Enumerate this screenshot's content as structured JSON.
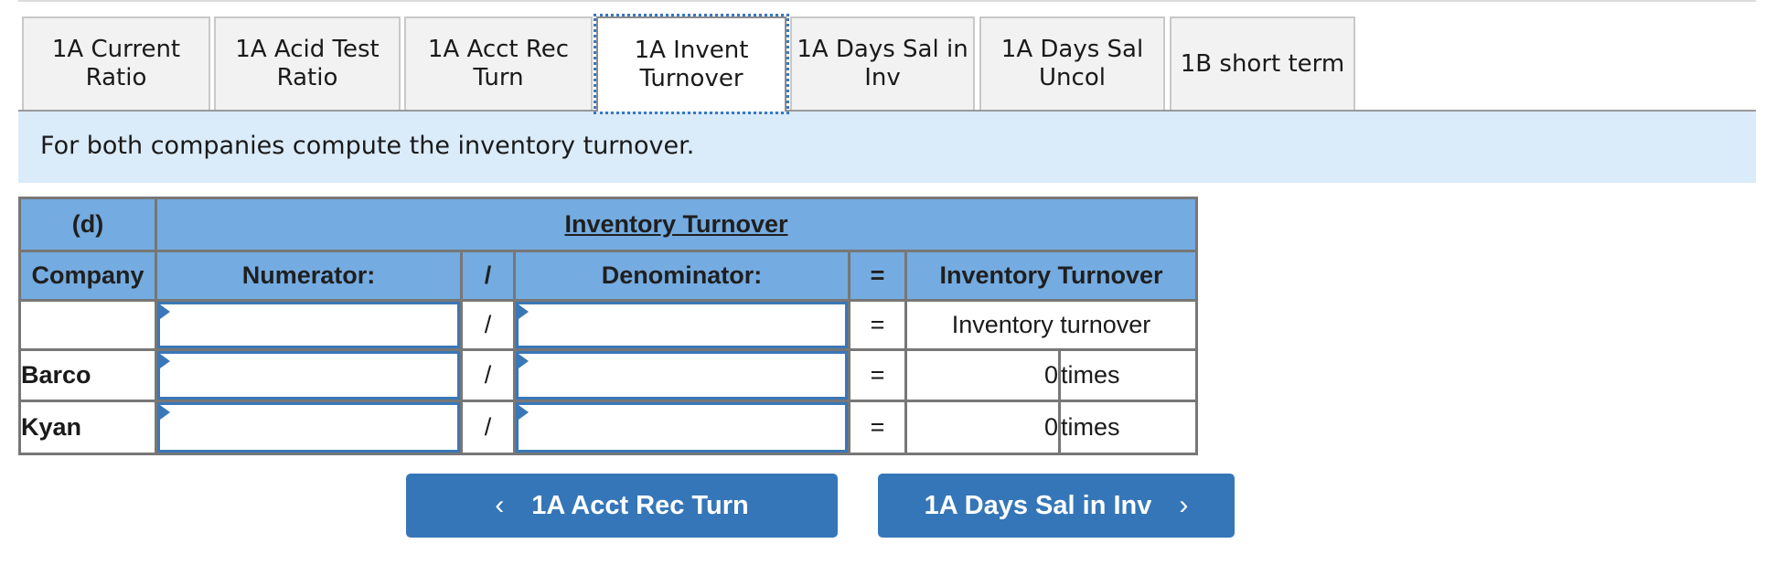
{
  "tabs": [
    {
      "label": "1A Current\nRatio",
      "active": false
    },
    {
      "label": "1A Acid Test\nRatio",
      "active": false
    },
    {
      "label": "1A Acct Rec\nTurn",
      "active": false
    },
    {
      "label": "1A Invent\nTurnover",
      "active": true
    },
    {
      "label": "1A Days Sal in\nInv",
      "active": false
    },
    {
      "label": "1A Days Sal\nUncol",
      "active": false
    },
    {
      "label": "1B short term",
      "active": false
    }
  ],
  "instruction": "For both companies compute the inventory turnover.",
  "table": {
    "part_label": "(d)",
    "title": "Inventory Turnover",
    "headers": {
      "company": "Company",
      "numerator": "Numerator:",
      "divide": "/",
      "denominator": "Denominator:",
      "equals": "=",
      "result": "Inventory Turnover"
    },
    "formula_row": {
      "company": "",
      "numerator": "",
      "divide": "/",
      "denominator": "",
      "equals": "=",
      "result": "Inventory turnover"
    },
    "rows": [
      {
        "company": "Barco",
        "numerator": "",
        "divide": "/",
        "denominator": "",
        "equals": "=",
        "value": "0",
        "unit": "times"
      },
      {
        "company": "Kyan",
        "numerator": "",
        "divide": "/",
        "denominator": "",
        "equals": "=",
        "value": "0",
        "unit": "times"
      }
    ]
  },
  "nav": {
    "prev_label": "1A Acct Rec Turn",
    "next_label": "1A Days Sal in Inv",
    "prev_icon": "‹",
    "next_icon": "›"
  },
  "colors": {
    "header_bg": "#74abe0",
    "band_bg": "#daebf9",
    "button_bg": "#3576b8",
    "input_border": "#3a77b8"
  }
}
